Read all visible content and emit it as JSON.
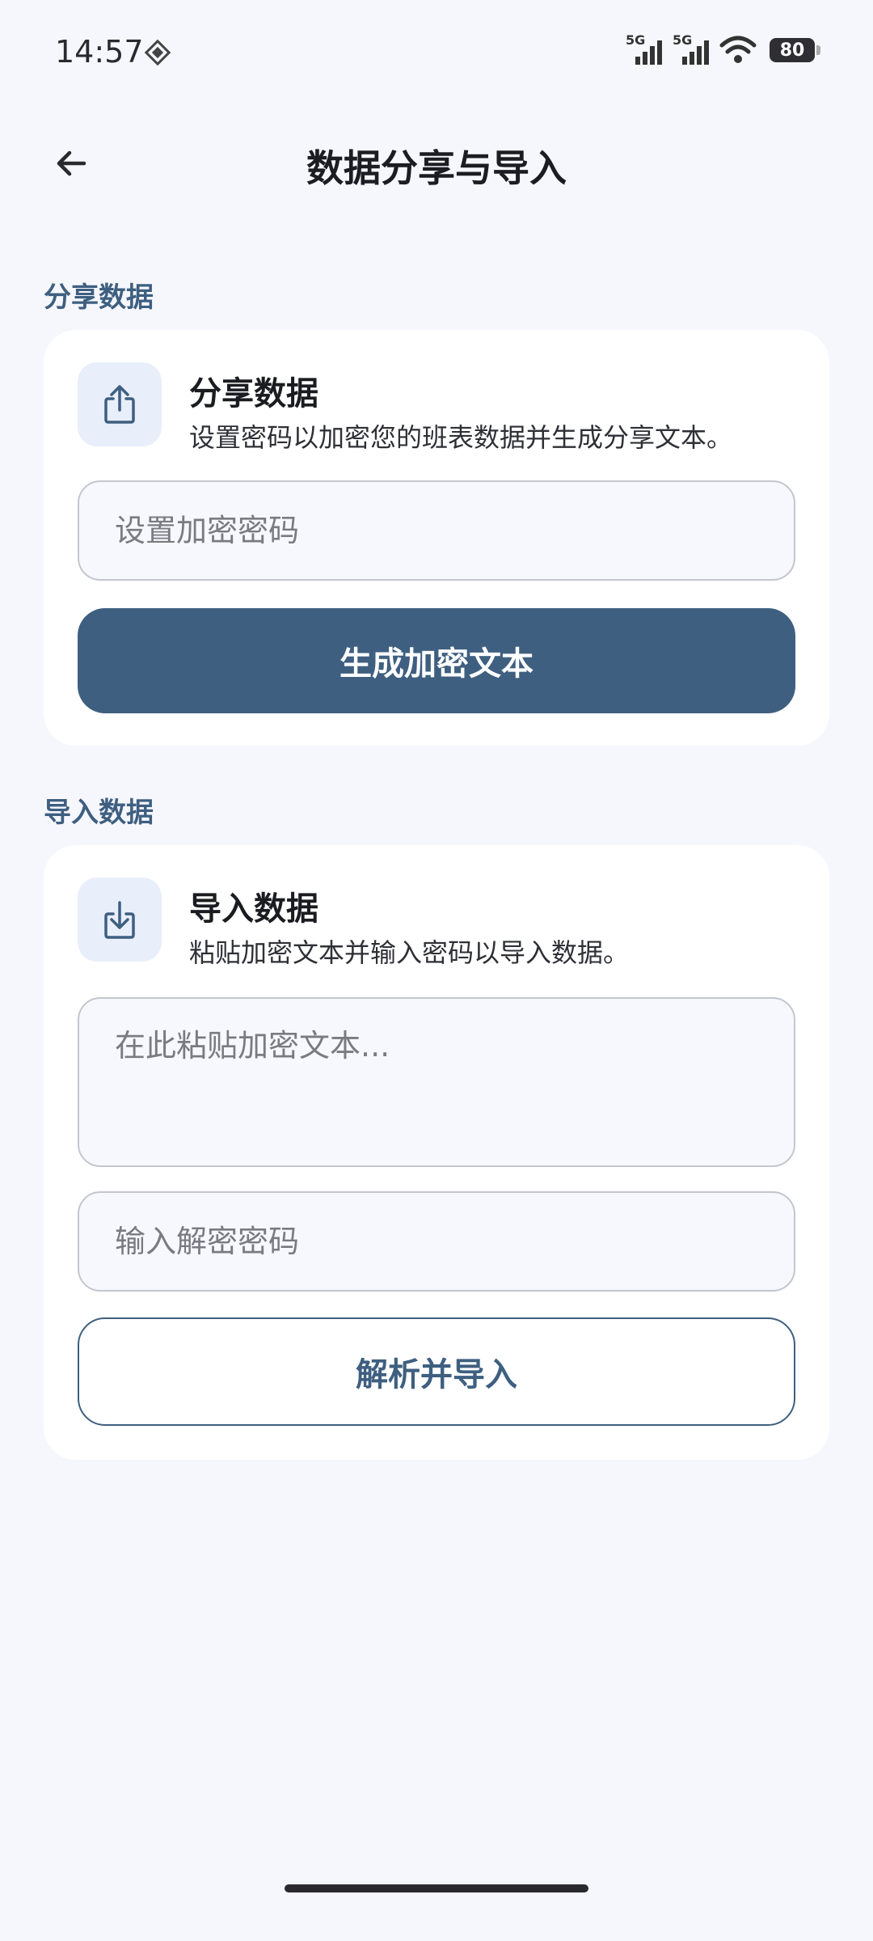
{
  "status_bar": {
    "time": "14:57",
    "signal1": "5G",
    "signal2": "5G",
    "battery": "80"
  },
  "header": {
    "title": "数据分享与导入"
  },
  "share_section": {
    "label": "分享数据",
    "card_title": "分享数据",
    "card_desc": "设置密码以加密您的班表数据并生成分享文本。",
    "password_placeholder": "设置加密密码",
    "button_label": "生成加密文本"
  },
  "import_section": {
    "label": "导入数据",
    "card_title": "导入数据",
    "card_desc": "粘贴加密文本并输入密码以导入数据。",
    "text_placeholder": "在此粘贴加密文本...",
    "password_placeholder": "输入解密密码",
    "button_label": "解析并导入"
  }
}
